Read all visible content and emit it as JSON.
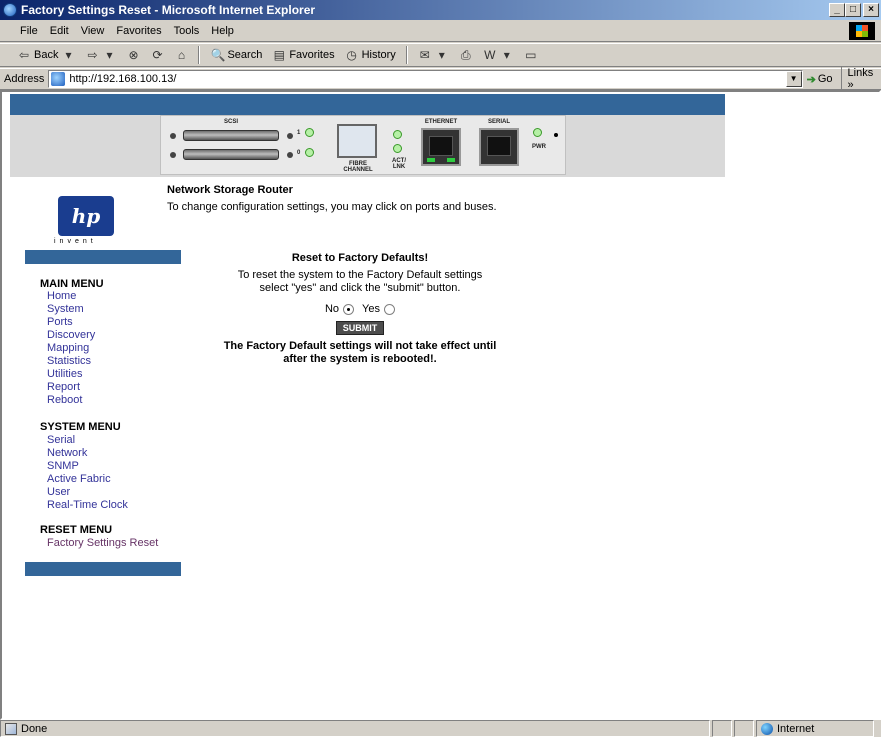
{
  "window": {
    "title": "Factory Settings Reset - Microsoft Internet Explorer"
  },
  "menubar": [
    "File",
    "Edit",
    "View",
    "Favorites",
    "Tools",
    "Help"
  ],
  "toolbar": {
    "back": "Back",
    "search": "Search",
    "favorites": "Favorites",
    "history": "History"
  },
  "address": {
    "label": "Address",
    "url": "http://192.168.100.13/",
    "go": "Go",
    "links": "Links"
  },
  "device": {
    "scsi": "SCSI",
    "port1": "1",
    "port0": "0",
    "fibre": "FIBRE\nCHANNEL",
    "act": "ACT/\nLNK",
    "ethernet": "ETHERNET",
    "serial": "SERIAL",
    "pwr": "PWR"
  },
  "logo": {
    "mark": "hp",
    "tagline": "invent"
  },
  "page": {
    "heading": "Network Storage Router",
    "intro": "To change configuration settings, you may click on ports and buses."
  },
  "menus": {
    "main_title": "MAIN MENU",
    "main_items": [
      "Home",
      "System",
      "Ports",
      "Discovery",
      "Mapping",
      "Statistics",
      "Utilities",
      "Report",
      "Reboot"
    ],
    "system_title": "SYSTEM MENU",
    "system_items": [
      "Serial",
      "Network",
      "SNMP",
      "Active Fabric",
      "User",
      "Real-Time Clock"
    ],
    "reset_title": "RESET MENU",
    "reset_items": [
      "Factory Settings Reset"
    ]
  },
  "reset": {
    "title": "Reset to Factory Defaults!",
    "desc_line1": "To reset the system to the Factory Default settings",
    "desc_line2": "select \"yes\" and click the \"submit\" button.",
    "no_label": "No",
    "yes_label": "Yes",
    "selected": "No",
    "submit": "SUBMIT",
    "note_line1": "The Factory Default settings will not take effect until",
    "note_line2": "after the system is rebooted!."
  },
  "status": {
    "text": "Done",
    "zone": "Internet"
  }
}
